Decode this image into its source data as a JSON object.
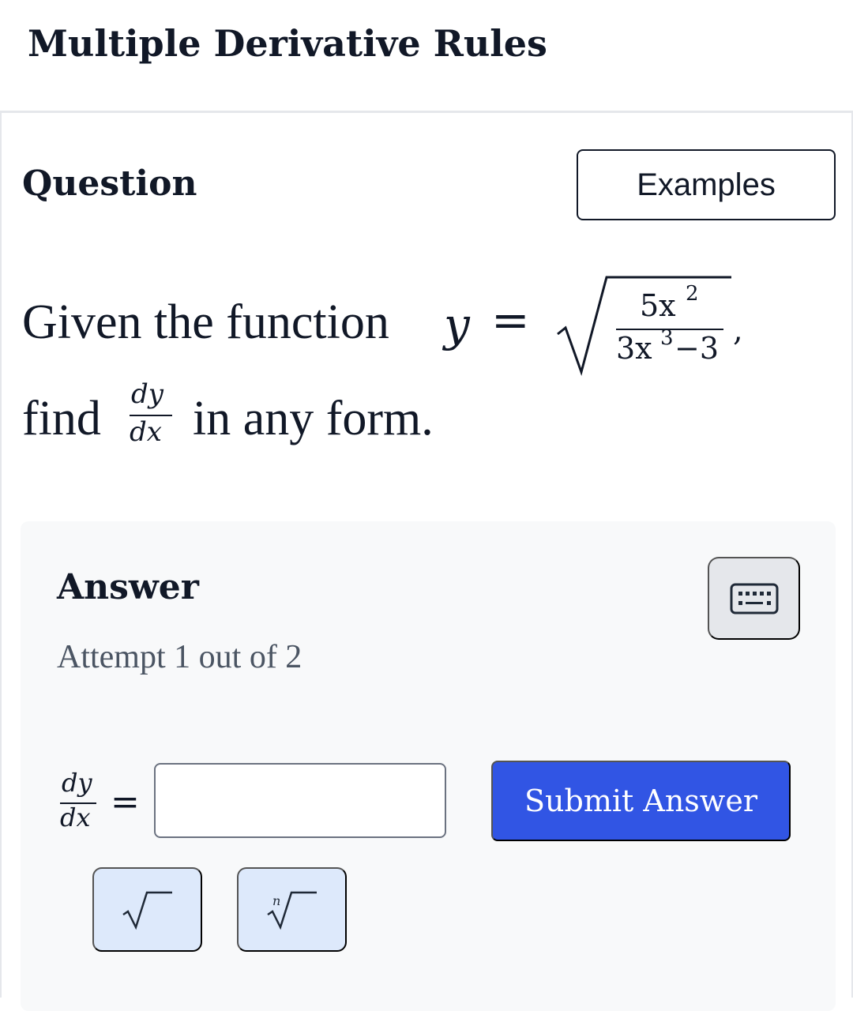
{
  "header": {
    "title": "Multiple Derivative Rules"
  },
  "question": {
    "heading": "Question",
    "examples_label": "Examples",
    "text_given": "Given the function",
    "text_find": "find",
    "text_any_form": "in any form.",
    "math": {
      "lhs_var": "y",
      "equals": "=",
      "numerator": "5x",
      "numerator_exp": "2",
      "denominator": "3x",
      "denominator_exp": "3",
      "denominator_tail": "−3",
      "comma": ",",
      "deriv_num": "dy",
      "deriv_den": "dx"
    }
  },
  "answer": {
    "heading": "Answer",
    "attempt": "Attempt 1 out of 2",
    "lhs_num": "dy",
    "lhs_den": "dx",
    "equals": "=",
    "input_value": "",
    "input_placeholder": "",
    "submit_label": "Submit Answer",
    "tool_nthroot_index": "n"
  },
  "icons": {
    "keyboard": "keyboard-icon",
    "sqrt": "square-root-icon",
    "nthroot": "nth-root-icon"
  },
  "colors": {
    "accent": "#3155e4",
    "tool_bg": "#dde9fb",
    "panel_bg": "#f8f9fa"
  }
}
